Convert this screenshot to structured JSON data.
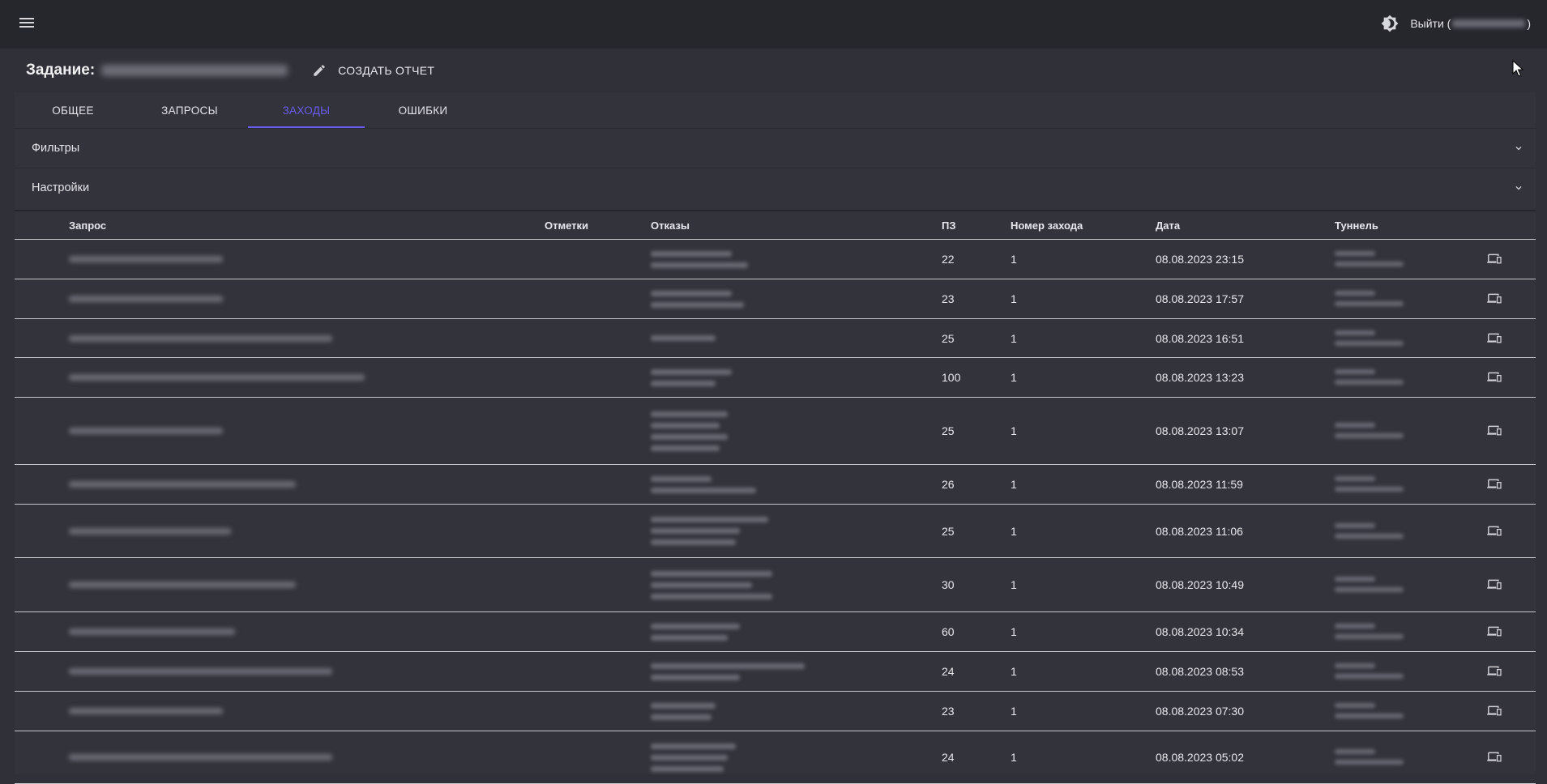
{
  "topbar": {
    "logout_label": "Выйти (",
    "logout_suffix": ")"
  },
  "page": {
    "task_label": "Задание:",
    "create_report_label": "СОЗДАТЬ ОТЧЕТ"
  },
  "tabs": [
    {
      "label": "ОБЩЕЕ"
    },
    {
      "label": "ЗАПРОСЫ"
    },
    {
      "label": "ЗАХОДЫ",
      "active": true
    },
    {
      "label": "ОШИБКИ"
    }
  ],
  "panels": {
    "filters": "Фильтры",
    "settings": "Настройки"
  },
  "table": {
    "columns": {
      "query": "Запрос",
      "marks": "Отметки",
      "refusals": "Отказы",
      "pz": "ПЗ",
      "visit_number": "Номер захода",
      "date": "Дата",
      "tunnel": "Туннель"
    },
    "rows": [
      {
        "pz": "22",
        "visit": "1",
        "date": "08.08.2023 23:15"
      },
      {
        "pz": "23",
        "visit": "1",
        "date": "08.08.2023 17:57"
      },
      {
        "pz": "25",
        "visit": "1",
        "date": "08.08.2023 16:51"
      },
      {
        "pz": "100",
        "visit": "1",
        "date": "08.08.2023 13:23"
      },
      {
        "pz": "25",
        "visit": "1",
        "date": "08.08.2023 13:07"
      },
      {
        "pz": "26",
        "visit": "1",
        "date": "08.08.2023 11:59"
      },
      {
        "pz": "25",
        "visit": "1",
        "date": "08.08.2023 11:06"
      },
      {
        "pz": "30",
        "visit": "1",
        "date": "08.08.2023 10:49"
      },
      {
        "pz": "60",
        "visit": "1",
        "date": "08.08.2023 10:34"
      },
      {
        "pz": "24",
        "visit": "1",
        "date": "08.08.2023 08:53"
      },
      {
        "pz": "23",
        "visit": "1",
        "date": "08.08.2023 07:30"
      },
      {
        "pz": "24",
        "visit": "1",
        "date": "08.08.2023 05:02"
      }
    ]
  },
  "colors": {
    "background": "#303038",
    "topbar": "#26262d",
    "accent": "#6a5cf0"
  },
  "icons": [
    "menu-icon",
    "theme-toggle-icon",
    "edit-icon",
    "chevron-down-icon",
    "device-icon"
  ]
}
